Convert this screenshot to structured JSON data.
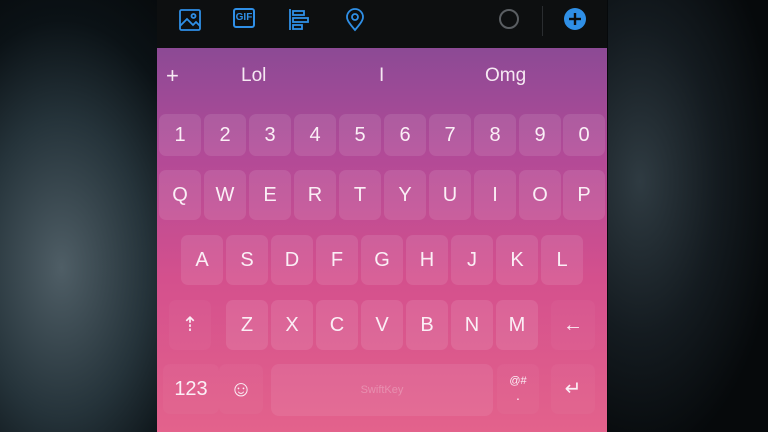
{
  "toolbar": {
    "icons": [
      "image-icon",
      "gif-icon",
      "format-icon",
      "location-icon",
      "circle-icon",
      "add-icon"
    ],
    "gif_label": "GIF",
    "accent_color": "#2f8fe6"
  },
  "suggestions": {
    "plus": "+",
    "items": [
      "Lol",
      "I",
      "Omg"
    ]
  },
  "keyboard": {
    "number_row": [
      "1",
      "2",
      "3",
      "4",
      "5",
      "6",
      "7",
      "8",
      "9",
      "0"
    ],
    "row1": [
      "Q",
      "W",
      "E",
      "R",
      "T",
      "Y",
      "U",
      "I",
      "O",
      "P"
    ],
    "row2": [
      "A",
      "S",
      "D",
      "F",
      "G",
      "H",
      "J",
      "K",
      "L"
    ],
    "row3": [
      "Z",
      "X",
      "C",
      "V",
      "B",
      "N",
      "M"
    ],
    "shift": "⇡",
    "backspace": "←",
    "numbers_key": "123",
    "emoji_key": "☺",
    "symbols_key": "@#",
    "symbols_sub": ".",
    "enter": "↵",
    "space_brand": "SwiftKey"
  }
}
